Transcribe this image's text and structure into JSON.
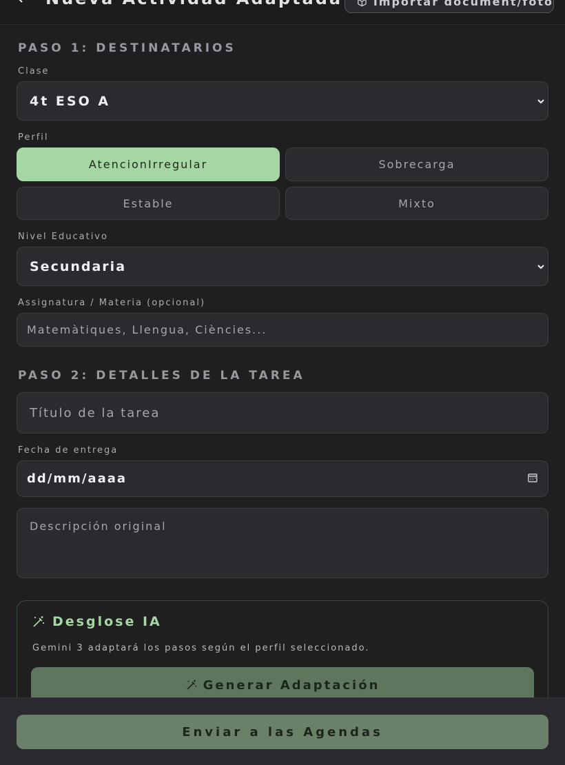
{
  "header": {
    "back_icon": "chevron-left-icon",
    "title": "Nueva Actividad Adaptada",
    "import_label": "Importar document/foto",
    "import_icon": "cube-icon"
  },
  "step1": {
    "title": "PASO 1: DESTINATARIOS",
    "class_label": "Clase",
    "class_value": "4t ESO A",
    "profile_label": "Perfil",
    "profiles": [
      "AtencionIrregular",
      "Sobrecarga",
      "Estable",
      "Mixto"
    ],
    "selected_profile": "AtencionIrregular",
    "level_label": "Nivel Educativo",
    "level_value": "Secundaria",
    "subject_label": "Assignatura / Materia (opcional)",
    "subject_placeholder": "Matemàtiques, Llengua, Ciències..."
  },
  "step2": {
    "title": "PASO 2: DETALLES DE LA TAREA",
    "task_title_placeholder": "Título de la tarea",
    "due_label": "Fecha de entrega",
    "due_value": "dd/mm/aaaa",
    "description_placeholder": "Descripción original"
  },
  "ai_card": {
    "title": "Desglose IA",
    "icon": "magic-wand-icon",
    "description": "Gemini 3 adaptará los pasos según el perfil seleccionado.",
    "generate_label": "Generar Adaptación"
  },
  "footer": {
    "send_label": "Enviar a las Agendas"
  },
  "colors": {
    "accent": "#a5d6a3",
    "button_green": "#5f765e",
    "background": "#1f1e21"
  }
}
